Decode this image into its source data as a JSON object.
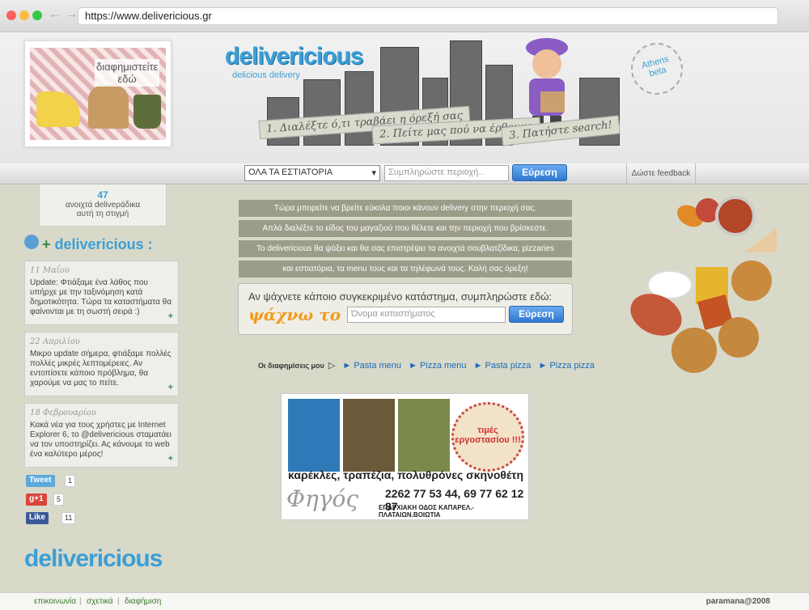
{
  "browser": {
    "url": "https://www.delivericious.gr"
  },
  "header": {
    "ad_text": "διαφημιστείτε εδώ",
    "logo": "delivericious",
    "tagline": "delicious delivery",
    "badge_line1": "Athens",
    "badge_line2": "beta",
    "steps": [
      "1. Διαλέξτε ό,τι τραβάει η όρεξή σας",
      "2. Πείτε μας πού να έρθουμε",
      "3. Πατήστε search!"
    ]
  },
  "search": {
    "category": "ΟΛΑ ΤΑ ΕΣΤΙΑΤΟΡΙΑ",
    "area_placeholder": "Συμπληρώστε περιοχή..",
    "button": "Εύρεση",
    "feedback": "Δώστε feedback"
  },
  "sidebar": {
    "open_count": "47",
    "open_label_1": "ανοιχτά deliveράδικα",
    "open_label_2": "αυτή τη στιγμή",
    "twitter_title": "delivericious :",
    "tweets": [
      {
        "date": "11 Μαΐου",
        "text": "Update: Φτιάξαμε ένα λάθος που υπήρχε με την ταξινόμηση κατά δημοτικότητα. Τώρα τα καταστήματα θα φαίνονται με τη σωστή σειρά :)"
      },
      {
        "date": "22 Απριλίου",
        "text": "Μικρο update σήμερα, φτιάξαμε πολλές πολλές μικρές λεπτομέρειες. Αν εντοπίσετε κάποιο πρόβλημα, θα χαρούμε να μας το πείτε."
      },
      {
        "date": "18 Φεβρουαρίου",
        "text": "Κακά νέα για τους χρήστες με Internet Explorer 6, το @delivericious σταματάει να τον υποστηρίζει. Ας κάνουμε το web ένα καλύτερο μέρος!"
      }
    ],
    "social": {
      "tweet_label": "Tweet",
      "tweet_count": "1",
      "gplus_label": "g+1",
      "gplus_count": "5",
      "like_label": "Like",
      "like_count": "11"
    },
    "bottom_logo": "delivericious"
  },
  "main": {
    "info_lines": [
      "Τώρα μπορείτε να βρείτε εύκολα ποιοι κάνουν delivery στην περιοχή σας.",
      "Απλά διαλέξτε το είδος του μαγαζιού που θέλετε και την περιοχή που βρίσκεστε.",
      "Το delivericious θα ψάξει και θα σας επιστρέψει τα ανοιχτά σουβλατζίδικα, pizzaries",
      "και εστιατόρια, τα menu τους και τα τηλέφωνά τους. Καλή σας όρεξη!"
    ],
    "store_search_title": "Αν ψάχνετε κάποιο συγκεκριμένο κατάστημα, συμπληρώστε εδώ:",
    "store_search_label": "ψάχνω το",
    "store_placeholder": "Όνομα καταστήματος",
    "store_button": "Εύρεση",
    "ads_label": "Οι διαφημίσεις μου",
    "ad_links": [
      "► Pasta menu",
      "► Pizza menu",
      "► Pasta pizza",
      "► Pizza pizza"
    ],
    "banner": {
      "seal": "τιμές εργοστασίου !!!",
      "tagline": "καρέκλες, τραπέζια, πολυθρόνες σκηνοθέτη",
      "brand": "Φηγός",
      "phones": "2262 77 53 44, 69 77 62 12 87",
      "address": "ΕΠΑΡΧΙΑΚΗ ΟΔΟΣ ΚΑΠΑΡΕΛ.-ΠΛΑΤΑΙΩΝ.ΒΟΙΩΤΙΑ"
    }
  },
  "footer": {
    "links": [
      "επικοινωνία",
      "σχετικά",
      "διαφήμιση"
    ],
    "credit": "paramana@2008"
  },
  "colors": {
    "brand": "#3b9fd6",
    "accent": "#f29a1c",
    "button": "#2f78d0"
  }
}
